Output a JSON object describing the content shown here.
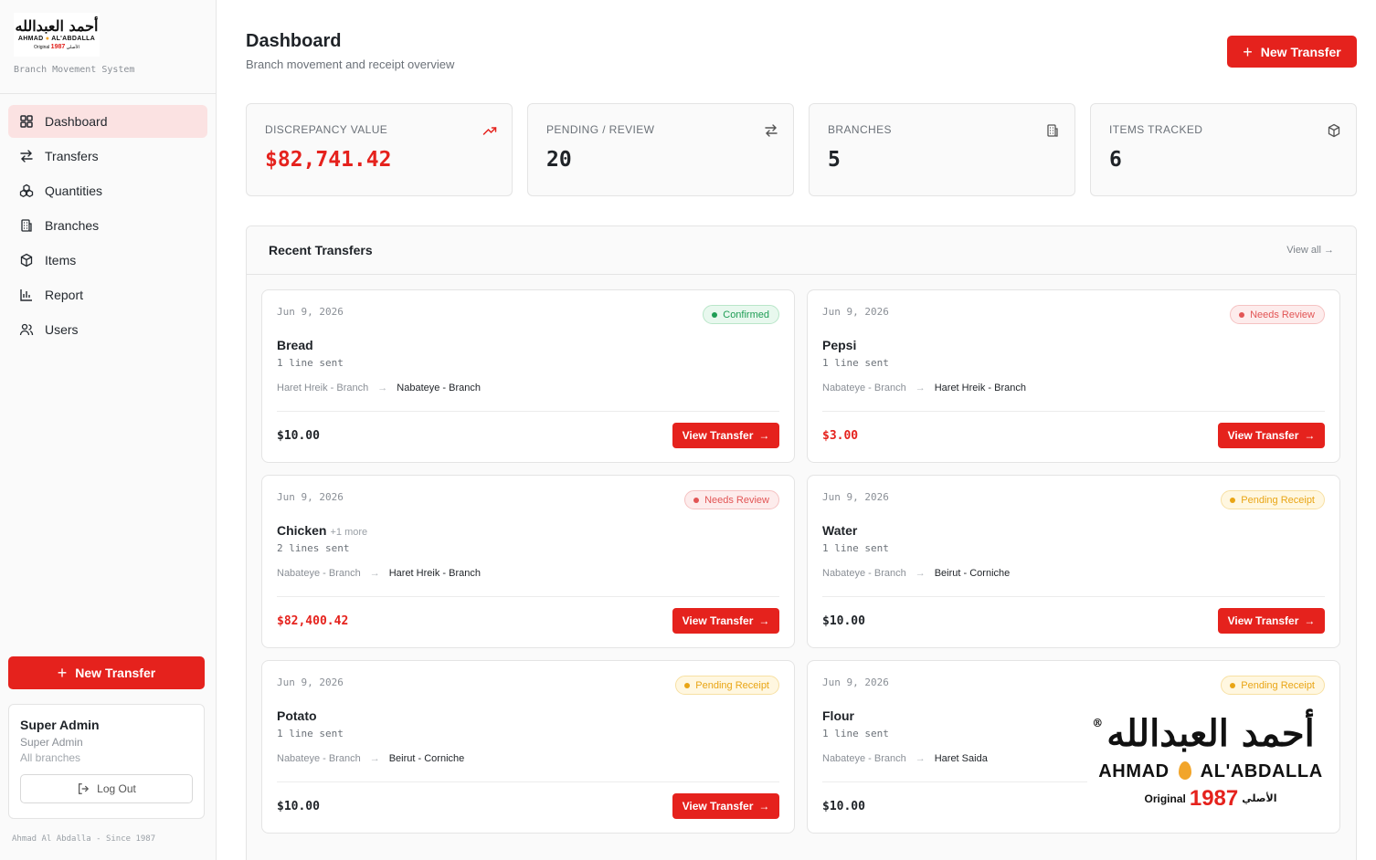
{
  "sidebar": {
    "logo": {
      "arabic": "أحمد العبدالله",
      "english_left": "AHMAD",
      "english_right": "AL'ABDALLA",
      "original": "Original",
      "year": "1987",
      "arabic_original": "الأصلي"
    },
    "subtitle": "Branch Movement System",
    "nav": [
      {
        "label": "Dashboard",
        "icon": "grid-icon",
        "active": true
      },
      {
        "label": "Transfers",
        "icon": "arrows-icon",
        "active": false
      },
      {
        "label": "Quantities",
        "icon": "boxes-icon",
        "active": false
      },
      {
        "label": "Branches",
        "icon": "building-icon",
        "active": false
      },
      {
        "label": "Items",
        "icon": "package-icon",
        "active": false
      },
      {
        "label": "Report",
        "icon": "bar-chart-icon",
        "active": false
      },
      {
        "label": "Users",
        "icon": "users-icon",
        "active": false
      }
    ],
    "new_transfer": "New Transfer",
    "user": {
      "name": "Super Admin",
      "role": "Super Admin",
      "scope": "All branches",
      "logout": "Log Out"
    },
    "footer": "Ahmad Al Abdalla - Since 1987"
  },
  "header": {
    "title": "Dashboard",
    "subtitle": "Branch movement and receipt overview",
    "new_transfer": "New Transfer"
  },
  "stats": [
    {
      "label": "DISCREPANCY VALUE",
      "value": "$82,741.42",
      "icon": "trending-up-icon",
      "accent": "#e5221d"
    },
    {
      "label": "PENDING / REVIEW",
      "value": "20",
      "icon": "arrows-icon"
    },
    {
      "label": "BRANCHES",
      "value": "5",
      "icon": "building-icon"
    },
    {
      "label": "ITEMS TRACKED",
      "value": "6",
      "icon": "package-icon"
    }
  ],
  "recent": {
    "title": "Recent Transfers",
    "view_all": "View all →",
    "cards": [
      {
        "date": "Jun 9, 2026",
        "status": "Confirmed",
        "item": "Bread",
        "more": "",
        "lines": "1 line sent",
        "from": "Haret Hreik - Branch",
        "to": "Nabateye - Branch",
        "amount": "$10.00",
        "amount_red": false,
        "button": "View Transfer"
      },
      {
        "date": "Jun 9, 2026",
        "status": "Needs Review",
        "item": "Pepsi",
        "more": "",
        "lines": "1 line sent",
        "from": "Nabateye - Branch",
        "to": "Haret Hreik - Branch",
        "amount": "$3.00",
        "amount_red": true,
        "button": "View Transfer"
      },
      {
        "date": "Jun 9, 2026",
        "status": "Needs Review",
        "item": "Chicken",
        "more": "+1 more",
        "lines": "2 lines sent",
        "from": "Nabateye - Branch",
        "to": "Haret Hreik - Branch",
        "amount": "$82,400.42",
        "amount_red": true,
        "button": "View Transfer"
      },
      {
        "date": "Jun 9, 2026",
        "status": "Pending Receipt",
        "item": "Water",
        "more": "",
        "lines": "1 line sent",
        "from": "Nabateye - Branch",
        "to": "Beirut - Corniche",
        "amount": "$10.00",
        "amount_red": false,
        "button": "View Transfer"
      },
      {
        "date": "Jun 9, 2026",
        "status": "Pending Receipt",
        "item": "Potato",
        "more": "",
        "lines": "1 line sent",
        "from": "Nabateye - Branch",
        "to": "Beirut - Corniche",
        "amount": "$10.00",
        "amount_red": false,
        "button": "View Transfer"
      },
      {
        "date": "Jun 9, 2026",
        "status": "Pending Receipt",
        "item": "Flour",
        "more": "",
        "lines": "1 line sent",
        "from": "Nabateye - Branch",
        "to": "Haret Saida",
        "amount": "$10.00",
        "amount_red": false,
        "button": ""
      }
    ]
  },
  "overlay_logo": {
    "arabic": "أحمد العبدالله",
    "english_left": "AHMAD",
    "english_right": "AL'ABDALLA",
    "original": "Original",
    "year": "1987",
    "arabic_original": "الأصلي"
  },
  "colors": {
    "accent": "#e5221d",
    "confirmed": "#1f9d55",
    "review": "#e25555",
    "pending": "#e9a515"
  }
}
